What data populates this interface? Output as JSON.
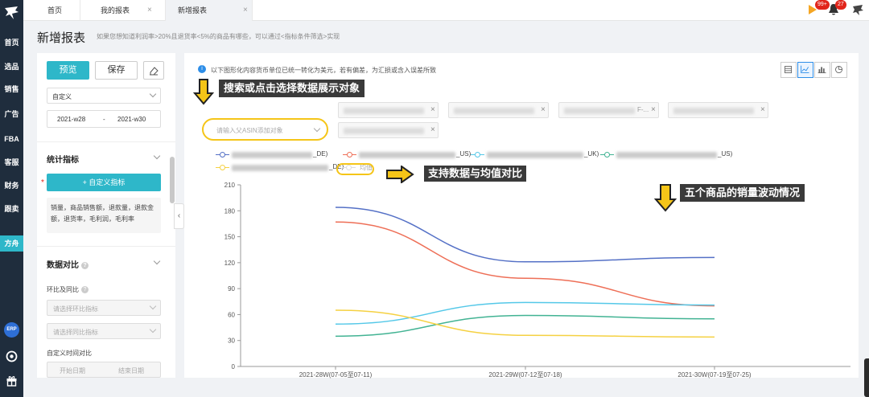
{
  "sidebar": {
    "items": [
      {
        "label": "首页",
        "active": false
      },
      {
        "label": "选品",
        "active": false
      },
      {
        "label": "销售",
        "active": false
      },
      {
        "label": "广告",
        "active": false
      },
      {
        "label": "FBA",
        "active": false
      },
      {
        "label": "客服",
        "active": false
      },
      {
        "label": "财务",
        "active": false
      },
      {
        "label": "跟卖",
        "active": false
      },
      {
        "label": "方舟",
        "active": true
      }
    ],
    "erp_label": "ERP",
    "logo_icon": "bird-logo-icon",
    "bottom_icons": [
      "settings-icon",
      "gift-icon"
    ]
  },
  "tabs": [
    {
      "label": "首页",
      "closable": false
    },
    {
      "label": "我的报表",
      "closable": true
    },
    {
      "label": "新增报表",
      "closable": true,
      "active": true
    }
  ],
  "header_icons": {
    "play_badge": "99+",
    "bell_badge": "27"
  },
  "page": {
    "title": "新增报表",
    "description": "如果您想知道利润率>20%且退货率<5%的商品有哪些，可以通过<指标条件筛选>实现"
  },
  "left_panel": {
    "preview_label": "预览",
    "save_label": "保存",
    "period_value": "自定义",
    "date_start": "2021-w28",
    "date_sep": "-",
    "date_end": "2021-w30",
    "metrics_title": "统计指标",
    "custom_metric_label": "+  自定义指标",
    "metrics_text": "销量，商品销售额，退款量，退款金额，退货率，毛利润，毛利率",
    "compare_title": "数据对比",
    "ratio_label": "环比及同比",
    "ratio_select1": "请选择环比指标",
    "ratio_select2": "请选择同比指标",
    "custom_time_label": "自定义时间对比",
    "start_date_placeholder": "开始日期",
    "end_date_placeholder": "结束日期"
  },
  "content": {
    "notice": "以下图形化内容货币单位已统一转化为美元，若有偏差，为汇损或含入误差所致",
    "view_icons": [
      "table-view-icon",
      "line-chart-icon",
      "bar-chart-icon",
      "pie-chart-icon"
    ],
    "active_view": 1,
    "asin_placeholder": "请输入父ASIN添加对象",
    "chip_suffixes": [
      "",
      "",
      "F-...",
      ""
    ],
    "annotation_search": "搜索或点击选择数据展示对象",
    "annotation_compare": "支持数据与均值对比",
    "annotation_trend": "五个商品的销量波动情况"
  },
  "legend": [
    {
      "suffix": "_DE)",
      "color": "#5470c6"
    },
    {
      "suffix": "_US)",
      "color": "#ee6f57"
    },
    {
      "suffix": "_UK)",
      "color": "#54c8e8"
    },
    {
      "suffix": "_US)",
      "color": "#42b393"
    },
    {
      "suffix": "_DE)",
      "color": "#f5d142"
    },
    {
      "suffix": "均值",
      "color": "#dddddd"
    }
  ],
  "chart_data": {
    "type": "line",
    "categories": [
      "2021-28W(07-05至07-11)",
      "2021-29W(07-12至07-18)",
      "2021-30W(07-19至07-25)"
    ],
    "ylim": [
      0,
      210
    ],
    "yticks": [
      0,
      30,
      60,
      90,
      120,
      150,
      180,
      210
    ],
    "grid": false,
    "series": [
      {
        "values": [
          184,
          121,
          126
        ],
        "color": "#5470c6"
      },
      {
        "values": [
          167,
          102,
          70
        ],
        "color": "#ee6f57"
      },
      {
        "values": [
          49,
          74,
          71
        ],
        "color": "#54c8e8"
      },
      {
        "values": [
          35,
          59,
          55
        ],
        "color": "#42b393"
      },
      {
        "values": [
          65,
          36,
          34
        ],
        "color": "#f5d142"
      }
    ]
  }
}
